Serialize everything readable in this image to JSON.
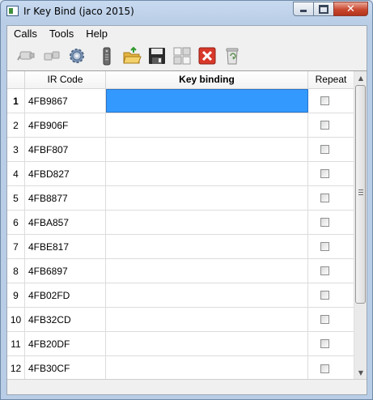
{
  "window": {
    "title": "Ir Key Bind (jaco 2015)"
  },
  "caption_buttons": {
    "close_glyph": "✕"
  },
  "menu": [
    {
      "label": "Calls"
    },
    {
      "label": "Tools"
    },
    {
      "label": "Help"
    }
  ],
  "toolbar": {
    "icons": [
      "connect-icon",
      "disconnect-icon",
      "settings-gear-icon",
      "remote-control-icon",
      "open-folder-icon",
      "save-icon",
      "grid-layout-icon",
      "delete-icon",
      "recycle-bin-icon"
    ]
  },
  "table": {
    "columns": {
      "ir_code": "IR Code",
      "key_binding": "Key binding",
      "repeat": "Repeat"
    },
    "rows": [
      {
        "num": "1",
        "code": "4FB9867",
        "binding": "",
        "repeat": false,
        "selected": true
      },
      {
        "num": "2",
        "code": "4FB906F",
        "binding": "",
        "repeat": false
      },
      {
        "num": "3",
        "code": "4FBF807",
        "binding": "",
        "repeat": false
      },
      {
        "num": "4",
        "code": "4FBD827",
        "binding": "",
        "repeat": false
      },
      {
        "num": "5",
        "code": "4FB8877",
        "binding": "",
        "repeat": false
      },
      {
        "num": "6",
        "code": "4FBA857",
        "binding": "",
        "repeat": false
      },
      {
        "num": "7",
        "code": "4FBE817",
        "binding": "",
        "repeat": false
      },
      {
        "num": "8",
        "code": "4FB6897",
        "binding": "",
        "repeat": false
      },
      {
        "num": "9",
        "code": "4FB02FD",
        "binding": "",
        "repeat": false
      },
      {
        "num": "10",
        "code": "4FB32CD",
        "binding": "",
        "repeat": false
      },
      {
        "num": "11",
        "code": "4FB20DF",
        "binding": "",
        "repeat": false
      },
      {
        "num": "12",
        "code": "4FB30CF",
        "binding": "",
        "repeat": false
      }
    ]
  },
  "scrollbar": {
    "up_glyph": "▲",
    "down_glyph": "▼"
  },
  "colors": {
    "selection": "#3399ff",
    "close_button": "#c9482f"
  }
}
